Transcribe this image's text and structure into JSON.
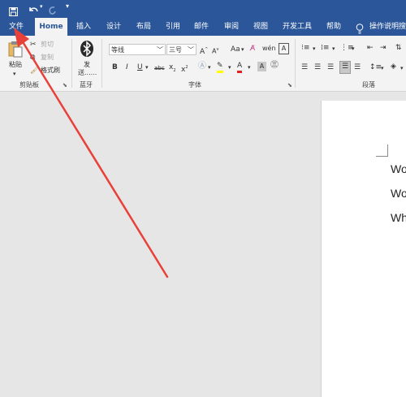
{
  "quick_access": {
    "save_icon": "save-icon",
    "undo_icon": "undo-icon",
    "redo_icon": "redo-icon",
    "customize_icon": "chevron-down-icon"
  },
  "tabs": [
    {
      "label": "文件"
    },
    {
      "label": "Home"
    },
    {
      "label": "插入"
    },
    {
      "label": "设计"
    },
    {
      "label": "布局"
    },
    {
      "label": "引用"
    },
    {
      "label": "邮件"
    },
    {
      "label": "审阅"
    },
    {
      "label": "视图"
    },
    {
      "label": "开发工具"
    },
    {
      "label": "帮助"
    },
    {
      "label": "操作说明搜"
    }
  ],
  "clipboard": {
    "paste_label": "粘贴",
    "cut_label": "剪切",
    "copy_label": "复制",
    "format_painter_label": "格式刷",
    "group_label": "剪贴板"
  },
  "bluetooth": {
    "send_label": "发",
    "send_label2": "送......",
    "group_label": "蓝牙"
  },
  "font": {
    "font_name": "等线",
    "font_size": "三号",
    "grow_label": "A",
    "shrink_label": "A",
    "case_label": "Aa",
    "bold": "B",
    "italic": "I",
    "underline": "U",
    "strike": "abc",
    "subscript": "x",
    "superscript": "x",
    "group_label": "字体"
  },
  "paragraph": {
    "group_label": "段落"
  },
  "document": {
    "lines": [
      "Wo",
      "Wo",
      "Wh"
    ]
  },
  "colors": {
    "accent": "#2b579a",
    "arrow": "#e8413a"
  }
}
